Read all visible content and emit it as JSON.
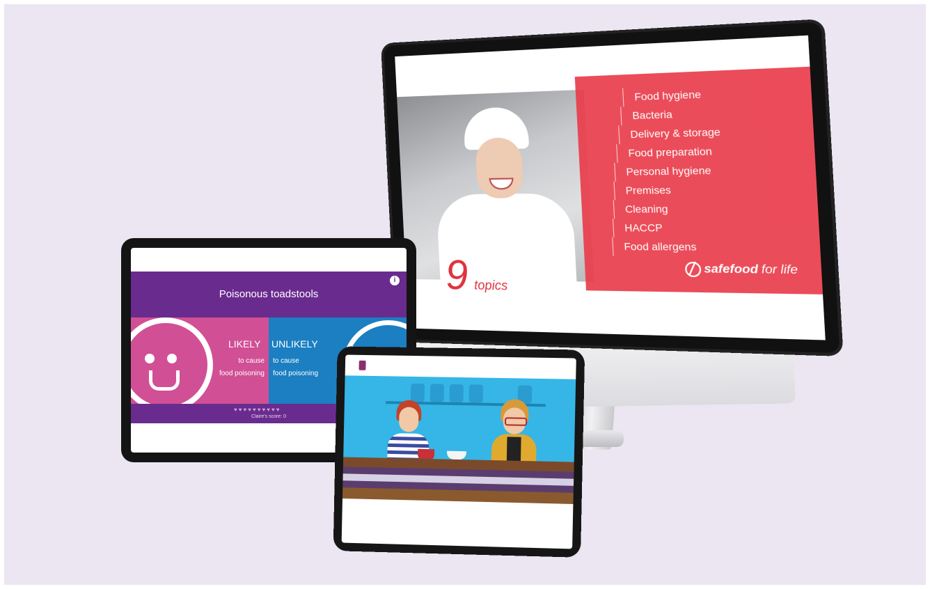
{
  "monitor": {
    "topics_number": "9",
    "topics_word": "topics",
    "topics": [
      "Food hygiene",
      "Bacteria",
      "Delivery & storage",
      "Food preparation",
      "Personal hygiene",
      "Premises",
      "Cleaning",
      "HACCP",
      "Food allergens"
    ],
    "brand_bold": "safefood",
    "brand_light": "for life",
    "accent_color": "#ea3d4b"
  },
  "tablet_left": {
    "title": "Poisonous toadstools",
    "info_icon": "info-icon",
    "likely": {
      "label": "LIKELY",
      "line1": "to cause",
      "line2": "food poisoning"
    },
    "unlikely": {
      "label": "UNLIKELY",
      "line1": "to cause",
      "line2": "food poisoning"
    },
    "hearts": "♥♥♥♥♥♥♥♥♥♥",
    "score": "Claire's score: 0",
    "colors": {
      "header": "#6a2b8e",
      "likely": "#d14f95",
      "unlikely": "#1b7fc1"
    }
  },
  "tablet_bottom": {
    "scene": "animated-cafe-scene",
    "colors": {
      "background": "#35b6e6"
    }
  }
}
